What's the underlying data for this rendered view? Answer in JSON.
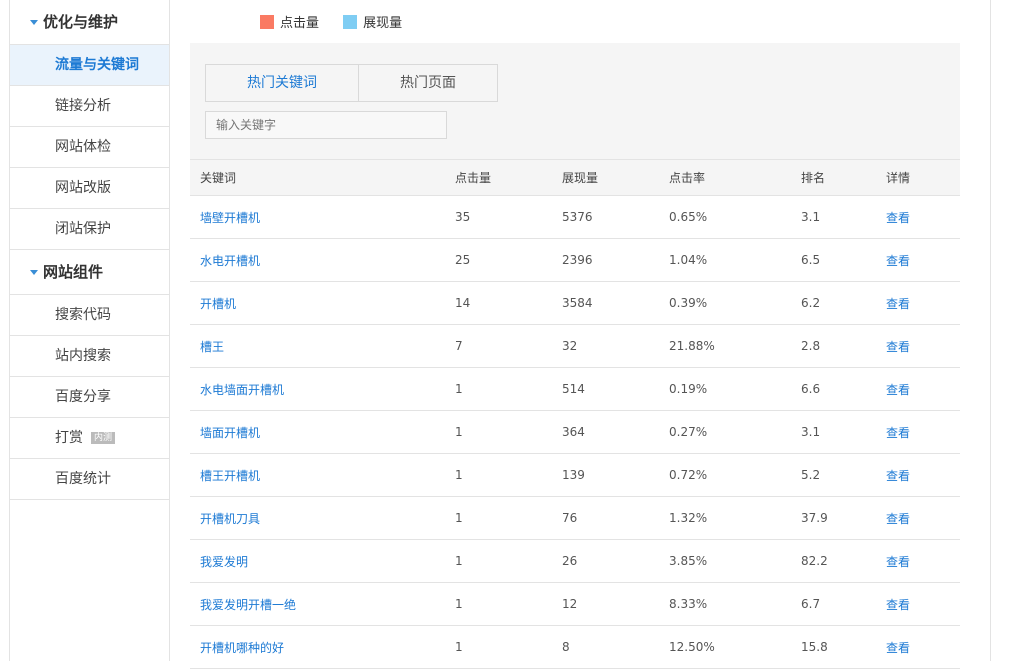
{
  "sidebar": {
    "groups": [
      {
        "title": "优化与维护",
        "items": [
          {
            "label": "流量与关键词"
          },
          {
            "label": "链接分析"
          },
          {
            "label": "网站体检"
          },
          {
            "label": "网站改版"
          },
          {
            "label": "闭站保护"
          }
        ]
      },
      {
        "title": "网站组件",
        "items": [
          {
            "label": "搜索代码"
          },
          {
            "label": "站内搜索"
          },
          {
            "label": "百度分享"
          },
          {
            "label": "打赏",
            "badge": "内测"
          },
          {
            "label": "百度统计"
          }
        ]
      }
    ]
  },
  "legend": [
    {
      "label": "点击量",
      "color": "#fa7a63"
    },
    {
      "label": "展现量",
      "color": "#7fcdf3"
    }
  ],
  "tabs": [
    "热门关键词",
    "热门页面"
  ],
  "search": {
    "placeholder": "输入关键字"
  },
  "table": {
    "headers": [
      "关键词",
      "点击量",
      "展现量",
      "点击率",
      "排名",
      "详情"
    ],
    "rows": [
      [
        "墙壁开槽机",
        "35",
        "5376",
        "0.65%",
        "3.1",
        "查看"
      ],
      [
        "水电开槽机",
        "25",
        "2396",
        "1.04%",
        "6.5",
        "查看"
      ],
      [
        "开槽机",
        "14",
        "3584",
        "0.39%",
        "6.2",
        "查看"
      ],
      [
        "槽王",
        "7",
        "32",
        "21.88%",
        "2.8",
        "查看"
      ],
      [
        "水电墙面开槽机",
        "1",
        "514",
        "0.19%",
        "6.6",
        "查看"
      ],
      [
        "墙面开槽机",
        "1",
        "364",
        "0.27%",
        "3.1",
        "查看"
      ],
      [
        "槽王开槽机",
        "1",
        "139",
        "0.72%",
        "5.2",
        "查看"
      ],
      [
        "开槽机刀具",
        "1",
        "76",
        "1.32%",
        "37.9",
        "查看"
      ],
      [
        "我爱发明",
        "1",
        "26",
        "3.85%",
        "82.2",
        "查看"
      ],
      [
        "我爱发明开槽一绝",
        "1",
        "12",
        "8.33%",
        "6.7",
        "查看"
      ],
      [
        "开槽机哪种的好",
        "1",
        "8",
        "12.50%",
        "15.8",
        "查看"
      ]
    ]
  }
}
